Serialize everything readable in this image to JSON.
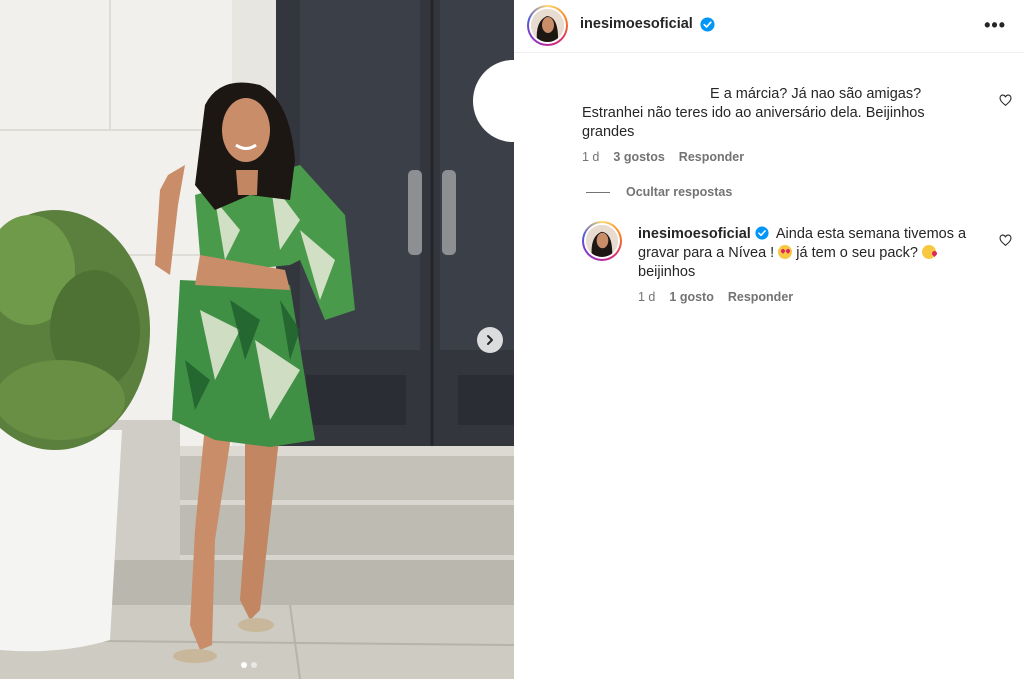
{
  "post": {
    "author": "inesimoesoficial",
    "carousel": {
      "slide_count": 2,
      "active_index": 0
    }
  },
  "comments": [
    {
      "text_line1": "E a márcia? Já nao são amigas?",
      "text_line2": "Estranhei não teres ido ao aniversário dela. Beijinhos",
      "text_line3": "grandes",
      "age": "1 d",
      "likes": "3 gostos",
      "reply_label": "Responder"
    }
  ],
  "hide_replies_label": "Ocultar respostas",
  "reply": {
    "username": "inesimoesoficial",
    "text_line1": "Ainda esta semana tivemos a",
    "text_line2a": "gravar para a Nívea !",
    "text_line2b": "já tem o seu pack?",
    "text_line3": "beijinhos",
    "age": "1 d",
    "likes": "1 gosto",
    "reply_label": "Responder"
  },
  "icons": {
    "verified": "verified-badge-icon",
    "more": "more-options-icon",
    "like": "heart-outline-icon",
    "next": "chevron-right-icon"
  },
  "colors": {
    "verified_blue": "#0095f6",
    "meta_gray": "#737373",
    "text": "#262626"
  }
}
